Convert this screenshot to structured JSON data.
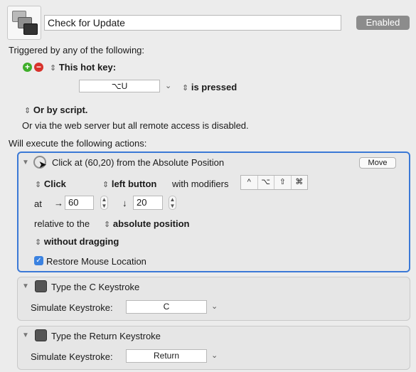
{
  "macro": {
    "name": "Check for Update",
    "enabled_label": "Enabled"
  },
  "triggers": {
    "heading": "Triggered by any of the following:",
    "hotkey_label": "This hot key:",
    "hotkey_value": "⌥U",
    "hotkey_state": "is pressed",
    "script_label": "Or by script.",
    "web_text": "Or via the web server but all remote access is disabled."
  },
  "actions": {
    "heading": "Will execute the following actions:",
    "click": {
      "title": "Click at (60,20) from the Absolute Position",
      "move_label": "Move",
      "click_type": "Click",
      "button": "left button",
      "modifiers_label": "with modifiers",
      "modifiers": [
        "^",
        "⌥",
        "⇧",
        "⌘"
      ],
      "at_label": "at",
      "right_arrow": "→",
      "x": "60",
      "down_arrow": "↓",
      "y": "20",
      "relative_label": "relative to the",
      "position": "absolute position",
      "drag": "without dragging",
      "restore_label": "Restore Mouse Location",
      "restore_checked": true
    },
    "keystroke1": {
      "title": "Type the C Keystroke",
      "label": "Simulate Keystroke:",
      "value": "C"
    },
    "keystroke2": {
      "title": "Type the Return Keystroke",
      "label": "Simulate Keystroke:",
      "value": "Return"
    }
  },
  "colors": {
    "accent": "#3b79d6",
    "enabled_bg": "#8c8c8c",
    "add": "#3fae2a",
    "remove": "#d7322b"
  }
}
